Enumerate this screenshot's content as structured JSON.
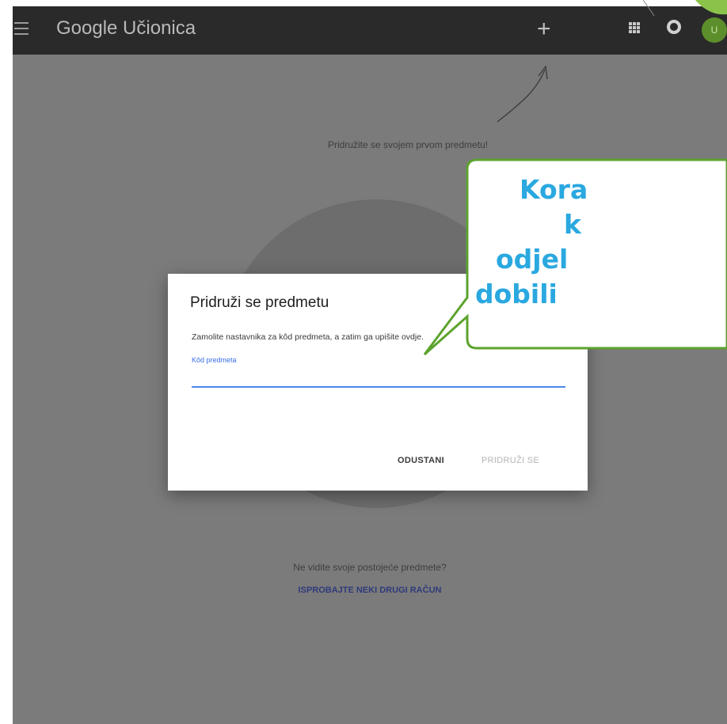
{
  "topbar": {
    "app_title": "Google Učionica",
    "plus_symbol": "+",
    "avatar_initials": "U",
    "menu_icon": "hamburger-icon",
    "apps_icon": "apps-grid-icon",
    "account_icon": "account-circle-icon"
  },
  "main": {
    "hint": "Pridružite se svojem prvom predmetu!",
    "no_classes_text": "Ne vidite svoje postojeće predmete?",
    "try_other_account": "ISPROBAJTE NEKI DRUGI RAČUN"
  },
  "dialog": {
    "title": "Pridruži se predmetu",
    "description": "Zamolite nastavnika za kôd predmeta, a zatim ga upišite ovdje.",
    "field_label": "Kôd predmeta",
    "field_value": "",
    "cancel_label": "ODUSTANI",
    "join_label": "PRIDRUŽI SE"
  },
  "callout": {
    "lines": [
      "Kora",
      "k",
      "odjel",
      "dobili"
    ]
  },
  "colors": {
    "topbar": "#2a2a2a",
    "overlay": "#7b7b7b",
    "callout_text": "#2aa8e0",
    "callout_border": "#5ca32e",
    "field_accent": "#4d86e8"
  }
}
